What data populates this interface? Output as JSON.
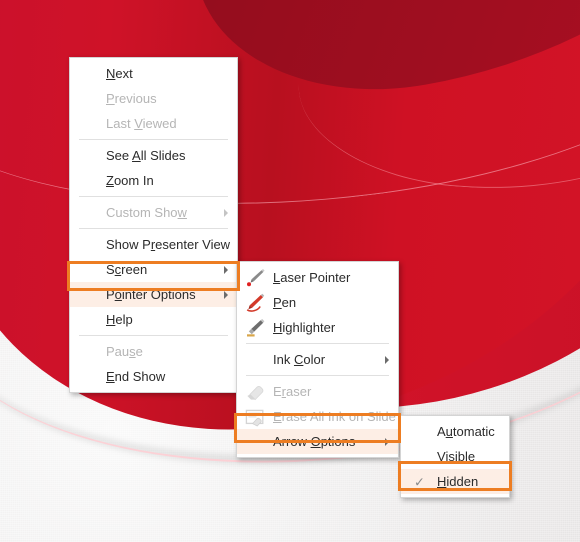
{
  "slide": {
    "theme_name": "red-curve-slideshow-background",
    "colors": {
      "red_primary": "#cf1228",
      "red_dark": "#9a0e1e",
      "pink_line": "#ffcdd2",
      "gray_bottom": "#efeeee",
      "menu_bg": "#ffffff",
      "menu_border": "#d4d4d4",
      "highlight_bg": "#fdeee5",
      "callout_orange": "#ed7d22",
      "text": "#2b2b2b",
      "text_disabled": "#b5b5b5"
    }
  },
  "context_menu": {
    "name": "slideshow-context-menu",
    "items": [
      {
        "label": "Next",
        "accel": "N",
        "disabled": false,
        "submenu": false,
        "separator_after": false
      },
      {
        "label": "Previous",
        "accel": "P",
        "disabled": true,
        "submenu": false,
        "separator_after": false
      },
      {
        "label": "Last Viewed",
        "accel": "V",
        "disabled": true,
        "submenu": false,
        "separator_after": true
      },
      {
        "label": "See All Slides",
        "accel": "A",
        "disabled": false,
        "submenu": false,
        "separator_after": false
      },
      {
        "label": "Zoom In",
        "accel": "Z",
        "disabled": false,
        "submenu": false,
        "separator_after": true
      },
      {
        "label": "Custom Show",
        "accel": "w",
        "disabled": true,
        "submenu": true,
        "separator_after": true
      },
      {
        "label": "Show Presenter View",
        "accel": "r",
        "disabled": false,
        "submenu": false,
        "separator_after": false
      },
      {
        "label": "Screen",
        "accel": "c",
        "disabled": false,
        "submenu": true,
        "separator_after": false
      },
      {
        "label": "Pointer Options",
        "accel": "o",
        "disabled": false,
        "submenu": true,
        "separator_after": false,
        "highlighted": true
      },
      {
        "label": "Help",
        "accel": "H",
        "disabled": false,
        "submenu": false,
        "separator_after": true
      },
      {
        "label": "Pause",
        "accel": "s",
        "disabled": true,
        "submenu": false,
        "separator_after": false
      },
      {
        "label": "End Show",
        "accel": "E",
        "disabled": false,
        "submenu": false,
        "separator_after": false
      }
    ]
  },
  "pointer_submenu": {
    "name": "pointer-options-submenu",
    "items": [
      {
        "label": "Laser Pointer",
        "accel": "L",
        "icon": "laser-pointer-icon",
        "disabled": false,
        "submenu": false,
        "separator_after": false
      },
      {
        "label": "Pen",
        "accel": "P",
        "icon": "pen-icon",
        "disabled": false,
        "submenu": false,
        "separator_after": false
      },
      {
        "label": "Highlighter",
        "accel": "H",
        "icon": "highlighter-icon",
        "disabled": false,
        "submenu": false,
        "separator_after": true
      },
      {
        "label": "Ink Color",
        "accel": "C",
        "icon": "",
        "disabled": false,
        "submenu": true,
        "separator_after": true
      },
      {
        "label": "Eraser",
        "accel": "r",
        "icon": "eraser-icon",
        "disabled": true,
        "submenu": false,
        "separator_after": false
      },
      {
        "label": "Erase All Ink on Slide",
        "accel": "E",
        "icon": "erase-all-ink-icon",
        "disabled": true,
        "submenu": false,
        "separator_after": false
      },
      {
        "label": "Arrow Options",
        "accel": "O",
        "icon": "",
        "disabled": false,
        "submenu": true,
        "separator_after": false,
        "highlighted": true
      }
    ]
  },
  "arrow_submenu": {
    "name": "arrow-options-submenu",
    "items": [
      {
        "label": "Automatic",
        "accel": "u",
        "checked": false,
        "highlighted": false
      },
      {
        "label": "Visible",
        "accel": "V",
        "checked": false,
        "highlighted": false
      },
      {
        "label": "Hidden",
        "accel": "H",
        "checked": true,
        "highlighted": true
      }
    ],
    "check_glyph": "✓"
  },
  "callouts": [
    {
      "name": "callout-pointer-options",
      "target": "Pointer Options"
    },
    {
      "name": "callout-arrow-options",
      "target": "Arrow Options"
    },
    {
      "name": "callout-hidden",
      "target": "Hidden"
    }
  ]
}
